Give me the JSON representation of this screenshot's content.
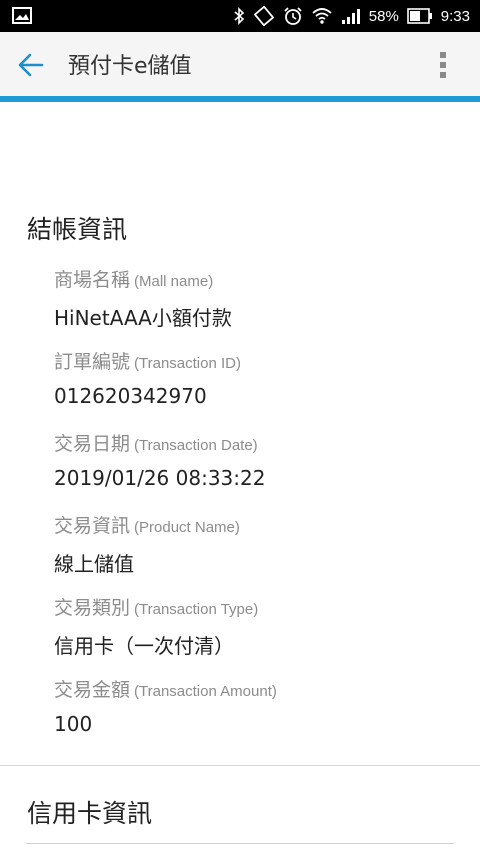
{
  "status_bar": {
    "battery": "58%",
    "time": "9:33",
    "icons": [
      "image-icon",
      "bluetooth-icon",
      "rotate-icon",
      "alarm-icon",
      "wifi-icon",
      "signal-icon",
      "battery-icon"
    ]
  },
  "app_bar": {
    "title": "預付卡e儲值",
    "back_icon": "arrow-left-icon",
    "menu_icon": "more-vertical-icon",
    "accent_color": "#1e9bd7"
  },
  "checkout": {
    "section_title": "結帳資訊",
    "fields": [
      {
        "label_zh": "商場名稱",
        "label_en": "(Mall name)",
        "value": "HiNetAAA小額付款"
      },
      {
        "label_zh": "訂單編號",
        "label_en": "(Transaction ID)",
        "value": "012620342970"
      },
      {
        "label_zh": "交易日期",
        "label_en": "(Transaction Date)",
        "value": "2019/01/26 08:33:22"
      },
      {
        "label_zh": "交易資訊",
        "label_en": "(Product Name)",
        "value": "線上儲值"
      },
      {
        "label_zh": "交易類別",
        "label_en": "(Transaction Type)",
        "value": "信用卡（一次付清）"
      },
      {
        "label_zh": "交易金額",
        "label_en": "(Transaction Amount)",
        "value": "100"
      }
    ]
  },
  "credit_card": {
    "section_title": "信用卡資訊"
  }
}
